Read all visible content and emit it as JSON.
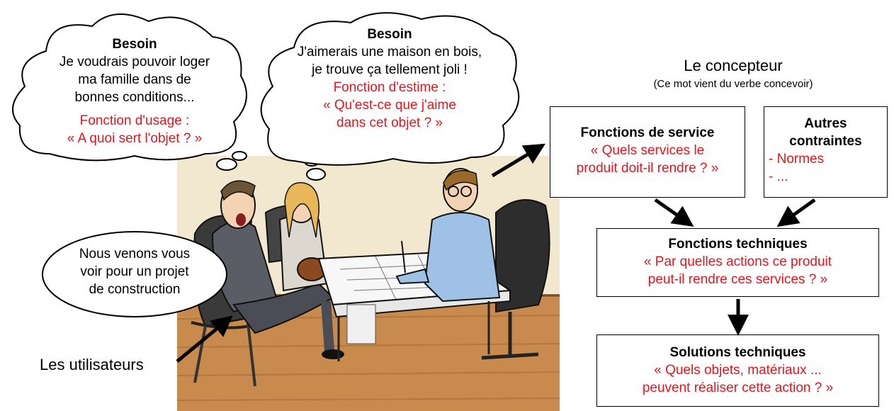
{
  "bubbles": {
    "left": {
      "title": "Besoin",
      "lines": [
        "Je voudrais pouvoir loger",
        "ma famille dans de",
        "bonnes conditions..."
      ],
      "func_label": "Fonction d'usage :",
      "func_question": "« A quoi sert l'objet ? »"
    },
    "middle": {
      "title": "Besoin",
      "lines": [
        "J'aimerais une maison en bois,",
        "je trouve ça tellement joli !"
      ],
      "func_label": "Fonction d'estime :",
      "func_lines": [
        "« Qu'est-ce que j'aime",
        "dans cet objet ? »"
      ]
    },
    "speech": {
      "lines": [
        "Nous venons vous",
        "voir pour un projet",
        "de construction"
      ]
    }
  },
  "users_label": "Les utilisateurs",
  "designer": {
    "title": "Le concepteur",
    "subtitle": "(Ce mot vient du verbe concevoir)"
  },
  "boxes": {
    "service": {
      "title": "Fonctions de service",
      "lines": [
        "« Quels services le",
        "produit doit-il rendre ? »"
      ]
    },
    "constraints": {
      "title_lines": [
        "Autres",
        "contraintes"
      ],
      "items": [
        "- Normes",
        "- ..."
      ]
    },
    "technical": {
      "title": "Fonctions techniques",
      "lines": [
        "« Par quelles actions ce produit",
        "peut-il rendre ces services ? »"
      ]
    },
    "solutions": {
      "title": "Solutions techniques",
      "lines": [
        "« Quels objets, matériaux ...",
        "peuvent réaliser cette action ? »"
      ]
    }
  },
  "colors": {
    "accent_red": "#e8141b",
    "border": "#000000",
    "floor": "#c98a4e",
    "wall": "#efe4c8"
  }
}
